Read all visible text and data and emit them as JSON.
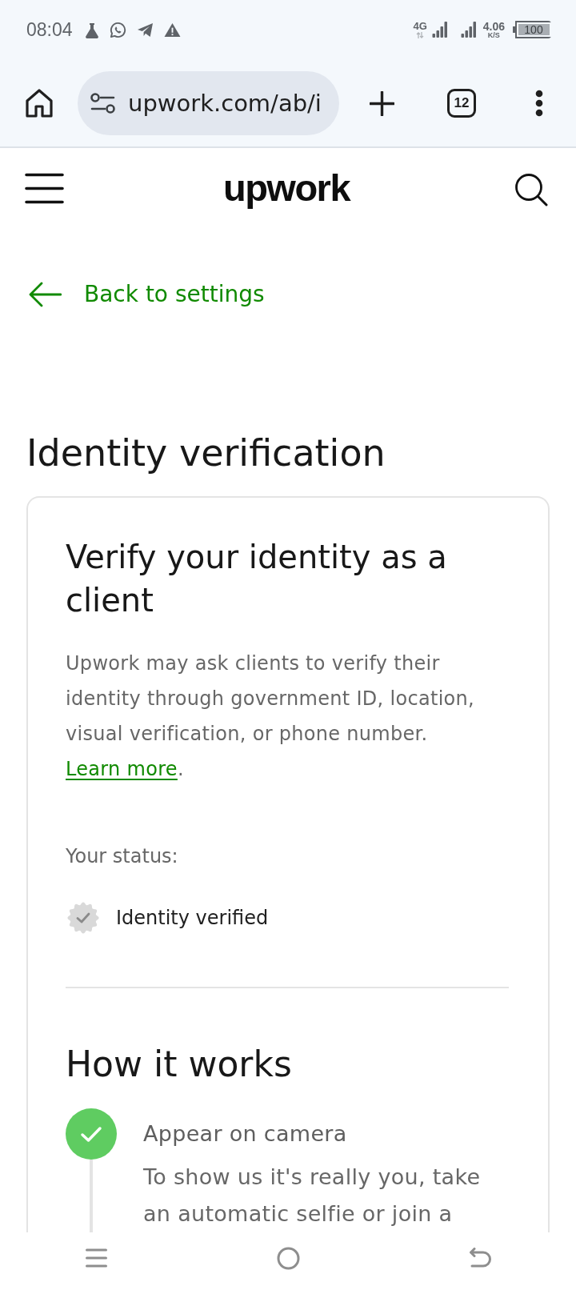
{
  "status_bar": {
    "time": "08:04",
    "network": "4G",
    "speed": "4.06",
    "speed_unit": "K/S",
    "battery": "100"
  },
  "browser": {
    "url": "upwork.com/ab/i",
    "tab_count": "12"
  },
  "header": {
    "logo": "upwork"
  },
  "back_link": {
    "label": "Back to settings"
  },
  "page_title": "Identity verification",
  "card": {
    "title": "Verify your identity as a client",
    "description": {
      "text": "Upwork may ask clients to verify their identity through government ID, location, visual verification, or phone number.",
      "link": "Learn more",
      "after_link": "."
    },
    "status_label": "Your status:",
    "status": {
      "label": "Identity verified",
      "verified": true
    }
  },
  "how_it_works": {
    "title": "How it works",
    "steps": [
      {
        "title": "Appear on camera",
        "text": "To show us it's really you, take an automatic selfie or join a",
        "done": true
      }
    ]
  }
}
